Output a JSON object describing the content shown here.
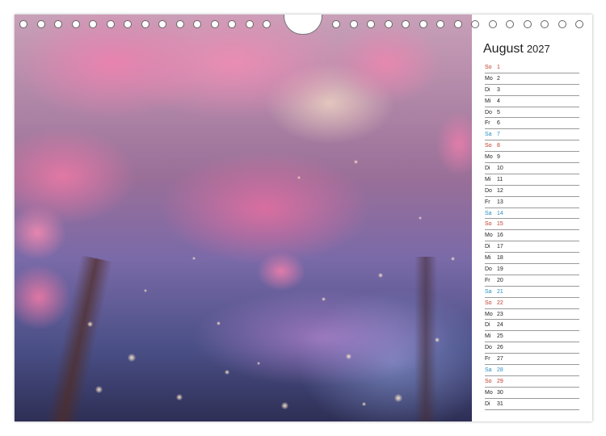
{
  "calendar": {
    "month": "August",
    "year": "2027",
    "days": [
      {
        "wd": "So",
        "day": "1",
        "kind": "sun"
      },
      {
        "wd": "Mo",
        "day": "2",
        "kind": ""
      },
      {
        "wd": "Di",
        "day": "3",
        "kind": ""
      },
      {
        "wd": "Mi",
        "day": "4",
        "kind": ""
      },
      {
        "wd": "Do",
        "day": "5",
        "kind": ""
      },
      {
        "wd": "Fr",
        "day": "6",
        "kind": ""
      },
      {
        "wd": "Sa",
        "day": "7",
        "kind": "sat"
      },
      {
        "wd": "So",
        "day": "8",
        "kind": "sun"
      },
      {
        "wd": "Mo",
        "day": "9",
        "kind": ""
      },
      {
        "wd": "Di",
        "day": "10",
        "kind": ""
      },
      {
        "wd": "Mi",
        "day": "11",
        "kind": ""
      },
      {
        "wd": "Do",
        "day": "12",
        "kind": ""
      },
      {
        "wd": "Fr",
        "day": "13",
        "kind": ""
      },
      {
        "wd": "Sa",
        "day": "14",
        "kind": "sat"
      },
      {
        "wd": "So",
        "day": "15",
        "kind": "sun"
      },
      {
        "wd": "Mo",
        "day": "16",
        "kind": ""
      },
      {
        "wd": "Di",
        "day": "17",
        "kind": ""
      },
      {
        "wd": "Mi",
        "day": "18",
        "kind": ""
      },
      {
        "wd": "Do",
        "day": "19",
        "kind": ""
      },
      {
        "wd": "Fr",
        "day": "20",
        "kind": ""
      },
      {
        "wd": "Sa",
        "day": "21",
        "kind": "sat"
      },
      {
        "wd": "So",
        "day": "22",
        "kind": "sun"
      },
      {
        "wd": "Mo",
        "day": "23",
        "kind": ""
      },
      {
        "wd": "Di",
        "day": "24",
        "kind": ""
      },
      {
        "wd": "Mi",
        "day": "25",
        "kind": ""
      },
      {
        "wd": "Do",
        "day": "26",
        "kind": ""
      },
      {
        "wd": "Fr",
        "day": "27",
        "kind": ""
      },
      {
        "wd": "Sa",
        "day": "28",
        "kind": "sat"
      },
      {
        "wd": "So",
        "day": "29",
        "kind": "sun"
      },
      {
        "wd": "Mo",
        "day": "30",
        "kind": ""
      },
      {
        "wd": "Di",
        "day": "31",
        "kind": ""
      }
    ]
  },
  "colors": {
    "saturday": "#2a8fbf",
    "sunday": "#c0392b",
    "blossom": "#e887b0"
  },
  "photo_subject": "cherry-blossom-photo"
}
